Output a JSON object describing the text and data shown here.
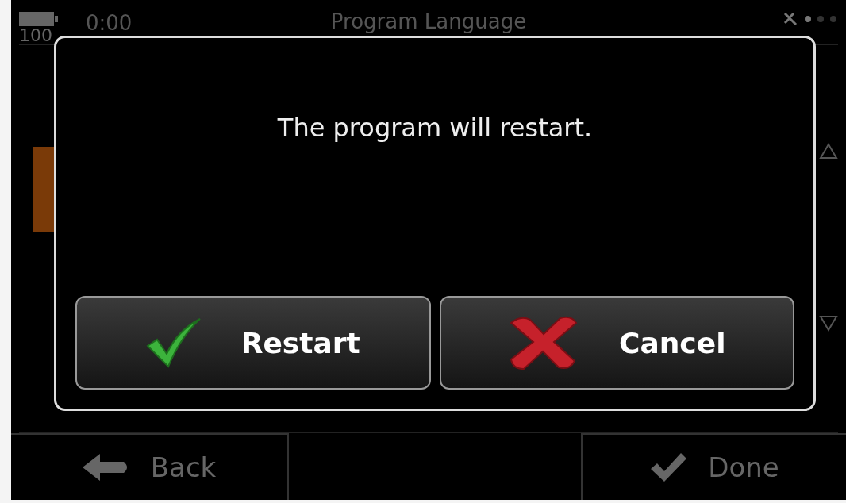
{
  "status_bar": {
    "battery": "100",
    "time": "0:00",
    "title": "Program Language"
  },
  "dialog": {
    "message": "The program will restart.",
    "buttons": [
      {
        "label": "Restart",
        "kind": "confirm"
      },
      {
        "label": "Cancel",
        "kind": "cancel"
      }
    ]
  },
  "footer_buttons": [
    {
      "label": "Back",
      "kind": "back"
    },
    {
      "label": "Done",
      "kind": "done"
    }
  ]
}
